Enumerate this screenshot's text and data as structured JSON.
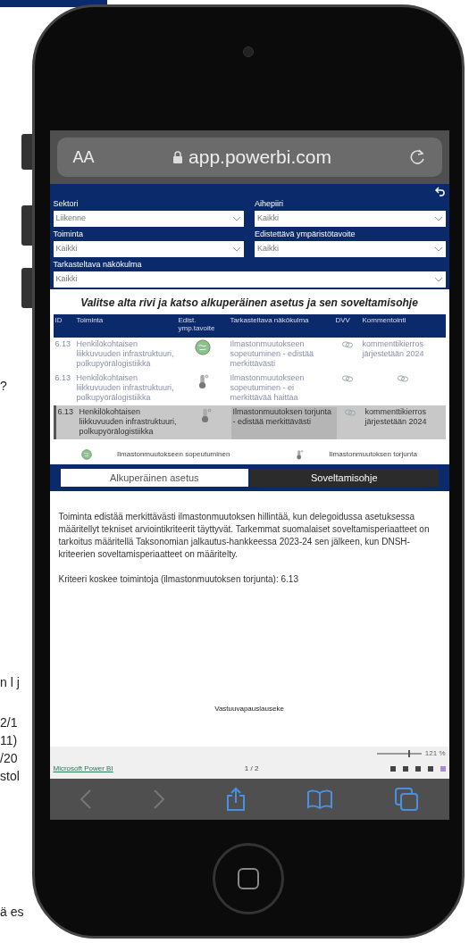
{
  "background_page": {
    "fragments": [
      "?",
      "n l j",
      "2/1",
      "11)",
      "/20",
      "stol",
      "ä es"
    ]
  },
  "browser": {
    "text_size": "AA",
    "url": "app.powerbi.com"
  },
  "filters": [
    {
      "label": "Sektori",
      "value": "Liikenne"
    },
    {
      "label": "Aihepiiri",
      "value": "Kaikki"
    },
    {
      "label": "Toiminta",
      "value": "Kaikki"
    },
    {
      "label": "Edistettävä ympäristötavoite",
      "value": "Kaikki"
    },
    {
      "label": "Tarkasteltava näkökulma",
      "value": "Kaikki"
    }
  ],
  "table": {
    "title": "Valitse alta rivi ja katso alkuperäinen asetus ja sen soveltamisohje",
    "columns": [
      "ID",
      "Toiminta",
      "Edist. ymp.tavoite",
      "Tarkasteltava näkökulma",
      "DVV",
      "Kommentointi"
    ],
    "rows": [
      {
        "id": "6.13",
        "toiminta": "Henkilökohtaisen liikkuvuuden infrastruktuuri, polkupyörälogistiikka",
        "kind": "adaptation",
        "nakokulma": "Ilmastonmuutokseen sopeutuminen - edistää merkittävästi",
        "kommentointi": "kommenttikierros järjestetään 2024",
        "selected": false
      },
      {
        "id": "6.13",
        "toiminta": "Henkilökohtaisen liikkuvuuden infrastruktuuri, polkupyörälogistiikka",
        "kind": "mitigation",
        "nakokulma": "Ilmastonmuutokseen sopeutuminen - ei merkittävää haittaa",
        "selected": false
      },
      {
        "id": "6.13",
        "toiminta": "Henkilökohtaisen liikkuvuuden infrastruktuuri, polkupyörälogistiikka",
        "kind": "mitigation",
        "nakokulma": "Ilmastonmuutoksen torjunta - edistää merkittävästi",
        "kommentointi": "kommenttikierros järjestetään 2024",
        "selected": true
      }
    ]
  },
  "legend": [
    {
      "kind": "adaptation",
      "label": "Ilmastonmuutokseen sopeutuminen"
    },
    {
      "kind": "mitigation",
      "label": "Ilmastonmuutoksen torjunta"
    }
  ],
  "tabs": [
    {
      "label": "Alkuperäinen asetus",
      "selected": false
    },
    {
      "label": "Soveltamisohje",
      "selected": true
    }
  ],
  "body": [
    "Toiminta edistää merkittävästi ilmastonmuutoksen hillintää, kun delegoidussa asetuksessa määritellyt tekniset arviointikriteerit täyttyvät. Tarkemmat suomalaiset soveltamisperiaatteet on tarkoitus määritellä Taksonomian jalkautus-hankkeessa 2023-24 sen jälkeen, kun DNSH-kriteerien soveltamisperiaatteet on määritelty.",
    "Kriteeri koskee toimintoja (ilmastonmuutoksen torjunta): 6.13"
  ],
  "disclaimer": "Vastuuvapauslauseke",
  "footer": {
    "brand": "Microsoft Power BI",
    "page": "1 / 2",
    "zoom": "121 %",
    "level": 0.7
  }
}
